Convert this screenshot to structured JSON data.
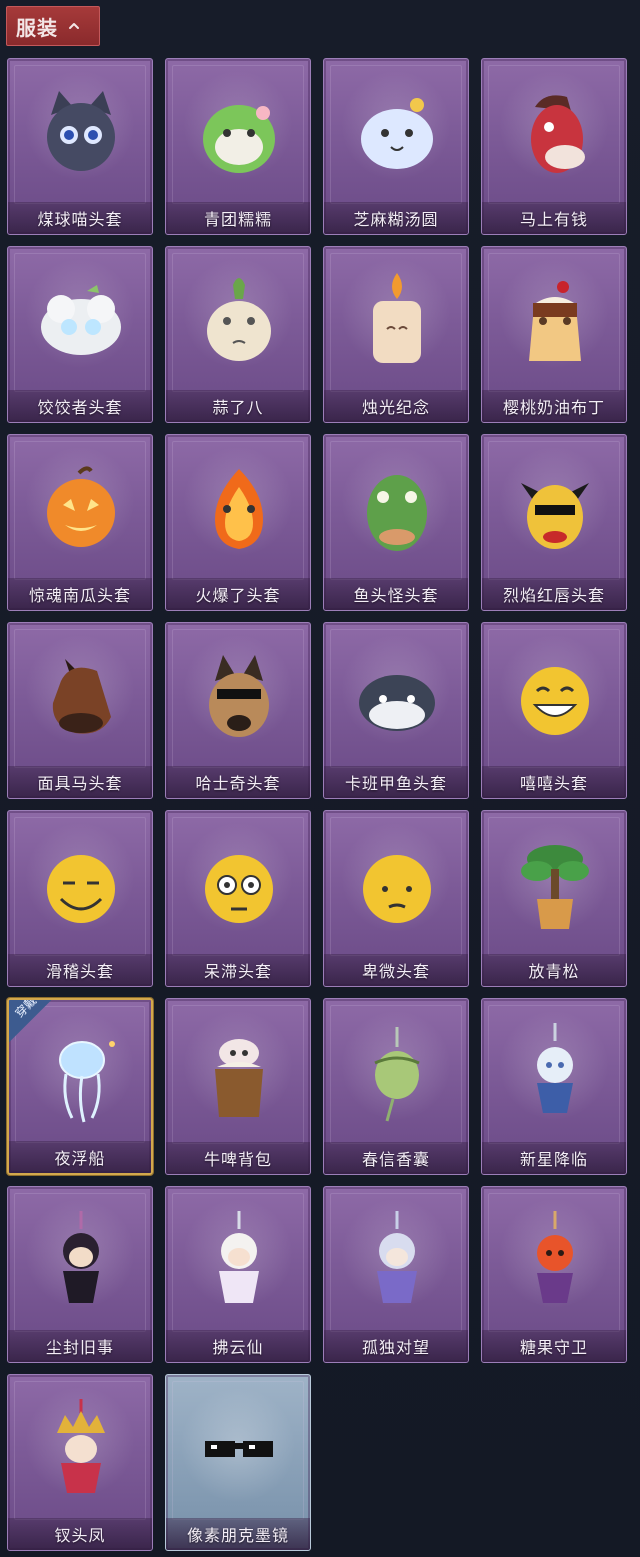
{
  "header": {
    "title": "服装"
  },
  "equipped_badge": "穿戴",
  "items": [
    {
      "name": "煤球喵头套",
      "icon": "black-cat-head-icon"
    },
    {
      "name": "青团糯糯",
      "icon": "green-dumpling-head-icon"
    },
    {
      "name": "芝麻糊汤圆",
      "icon": "white-dumpling-head-icon"
    },
    {
      "name": "马上有钱",
      "icon": "red-horse-head-icon"
    },
    {
      "name": "饺饺者头套",
      "icon": "dumpling-head-icon"
    },
    {
      "name": "蒜了八",
      "icon": "garlic-head-icon"
    },
    {
      "name": "烛光纪念",
      "icon": "candle-head-icon"
    },
    {
      "name": "樱桃奶油布丁",
      "icon": "pudding-head-icon"
    },
    {
      "name": "惊魂南瓜头套",
      "icon": "pumpkin-head-icon"
    },
    {
      "name": "火爆了头套",
      "icon": "fire-head-icon"
    },
    {
      "name": "鱼头怪头套",
      "icon": "fish-head-icon"
    },
    {
      "name": "烈焰红唇头套",
      "icon": "yellow-mask-head-icon"
    },
    {
      "name": "面具马头套",
      "icon": "horse-mask-icon"
    },
    {
      "name": "哈士奇头套",
      "icon": "husky-head-icon"
    },
    {
      "name": "卡班甲鱼头套",
      "icon": "turtle-head-icon"
    },
    {
      "name": "嘻嘻头套",
      "icon": "grin-emoji-head-icon"
    },
    {
      "name": "滑稽头套",
      "icon": "funny-emoji-head-icon"
    },
    {
      "name": "呆滞头套",
      "icon": "stunned-emoji-head-icon"
    },
    {
      "name": "卑微头套",
      "icon": "humble-emoji-head-icon"
    },
    {
      "name": "放青松",
      "icon": "bonsai-pine-icon"
    },
    {
      "name": "夜浮船",
      "icon": "jellyfish-icon",
      "equipped": true
    },
    {
      "name": "牛啤背包",
      "icon": "cow-beer-backpack-icon"
    },
    {
      "name": "春信香囊",
      "icon": "sachet-icon"
    },
    {
      "name": "新星降临",
      "icon": "star-charm-icon"
    },
    {
      "name": "尘封旧事",
      "icon": "dark-charm-icon"
    },
    {
      "name": "拂云仙",
      "icon": "cloud-fairy-charm-icon"
    },
    {
      "name": "孤独对望",
      "icon": "lonely-gaze-charm-icon"
    },
    {
      "name": "糖果守卫",
      "icon": "candy-guard-charm-icon"
    },
    {
      "name": "钗头凤",
      "icon": "phoenix-crown-charm-icon"
    },
    {
      "name": "像素朋克墨镜",
      "icon": "pixel-sunglasses-icon",
      "tier": "blue"
    }
  ]
}
